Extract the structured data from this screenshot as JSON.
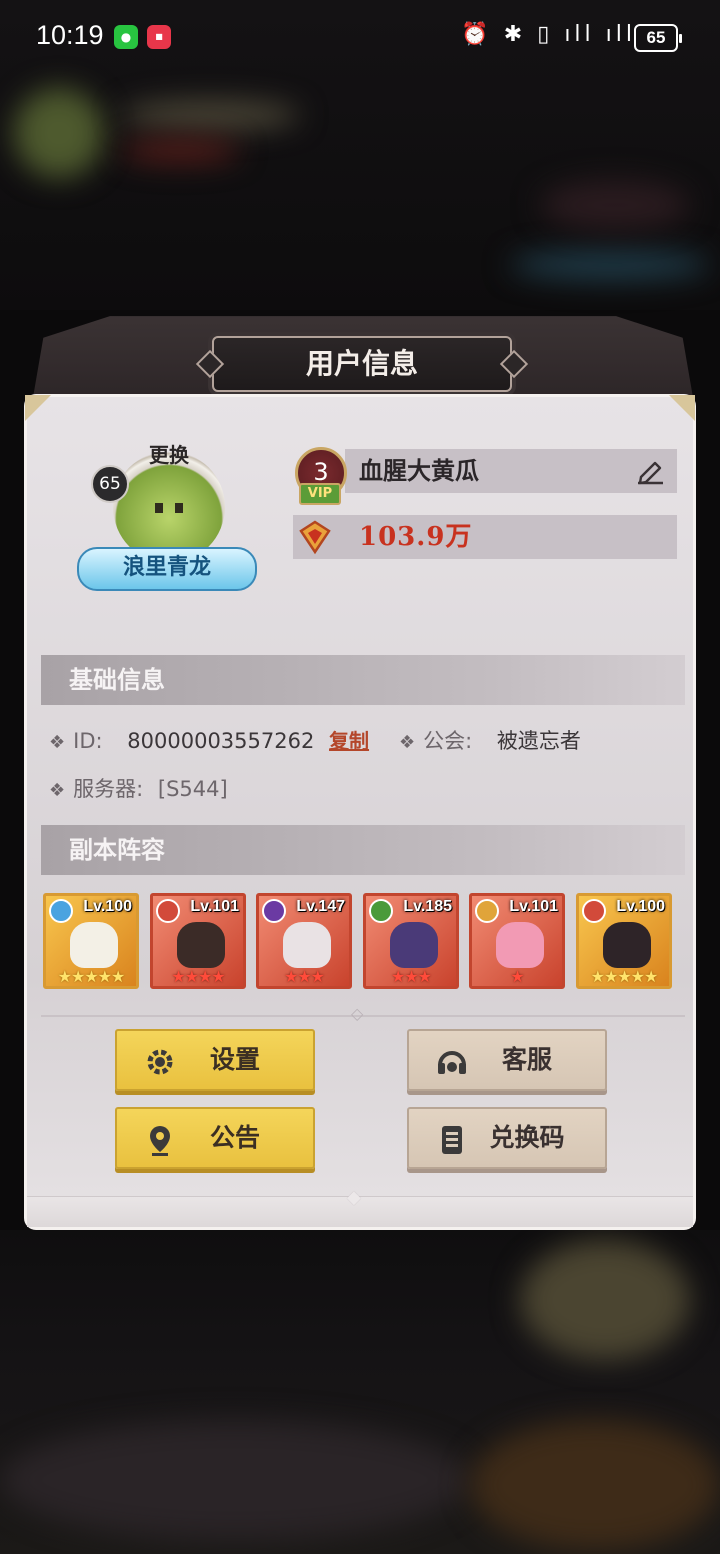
{
  "status_bar": {
    "time": "10:19",
    "battery": "65",
    "system_icons": "⏰ ✱ ▯ ıll ıll"
  },
  "dialog": {
    "title": "用户信息",
    "avatar": {
      "level": "65",
      "change_label": "更换",
      "title_ribbon": "浪里青龙"
    },
    "vip_level": "3",
    "vip_label": "VIP",
    "player_name": "血腥大黄瓜",
    "power": "103.9万",
    "basic_info": {
      "section_title": "基础信息",
      "id_label": "ID:",
      "id_value": "80000003557262",
      "copy_label": "复制",
      "guild_label": "公会:",
      "guild_value": "被遗忘者",
      "server_label": "服务器:",
      "server_value": "[S544]"
    },
    "lineup": {
      "section_title": "副本阵容",
      "heroes": [
        {
          "level": "Lv.100",
          "stars": "★★★★★",
          "frame": "gold"
        },
        {
          "level": "Lv.101",
          "stars": "★★★★",
          "frame": "red"
        },
        {
          "level": "Lv.147",
          "stars": "★★★",
          "frame": "red"
        },
        {
          "level": "Lv.185",
          "stars": "★★★",
          "frame": "red"
        },
        {
          "level": "Lv.101",
          "stars": "★",
          "frame": "red"
        },
        {
          "level": "Lv.100",
          "stars": "★★★★★",
          "frame": "gold"
        }
      ]
    },
    "buttons": {
      "settings": "设置",
      "customer_service": "客服",
      "announcement": "公告",
      "redeem_code": "兑换码"
    }
  },
  "colors": {
    "accent_yellow": "#f4d55a",
    "accent_beige": "#dccdbb",
    "power_red": "#c8321f",
    "link_red": "#b4462a"
  }
}
